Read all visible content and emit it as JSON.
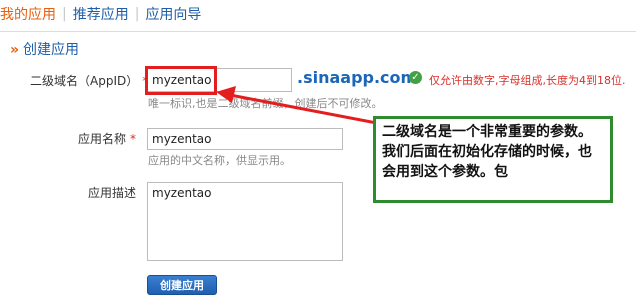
{
  "tabs": [
    {
      "label": "我的应用"
    },
    {
      "label": "推荐应用"
    },
    {
      "label": "应用向导"
    }
  ],
  "section_title": "创建应用",
  "form": {
    "appid": {
      "label": "二级域名（AppID）",
      "required_mark": "*",
      "value": "myzentao",
      "suffix": ".sinaapp.com",
      "rule": "仅允许由数字,字母组成,长度为4到18位.",
      "hint": "唯一标识,也是二级域名前缀，创建后不可修改。"
    },
    "name": {
      "label": "应用名称",
      "required_mark": "*",
      "value": "myzentao",
      "hint": "应用的中文名称，供显示用。"
    },
    "desc": {
      "label": "应用描述",
      "value": "myzentao"
    },
    "submit_label": "创建应用"
  },
  "annotation": {
    "callout_text": "二级域名是一个非常重要的参数。我们后面在初始化存储的时候，也会用到这个参数。包",
    "highlight_color": "#e41e1e",
    "arrow_color": "#e41e1e",
    "callout_border_color": "#2e8b2e"
  }
}
